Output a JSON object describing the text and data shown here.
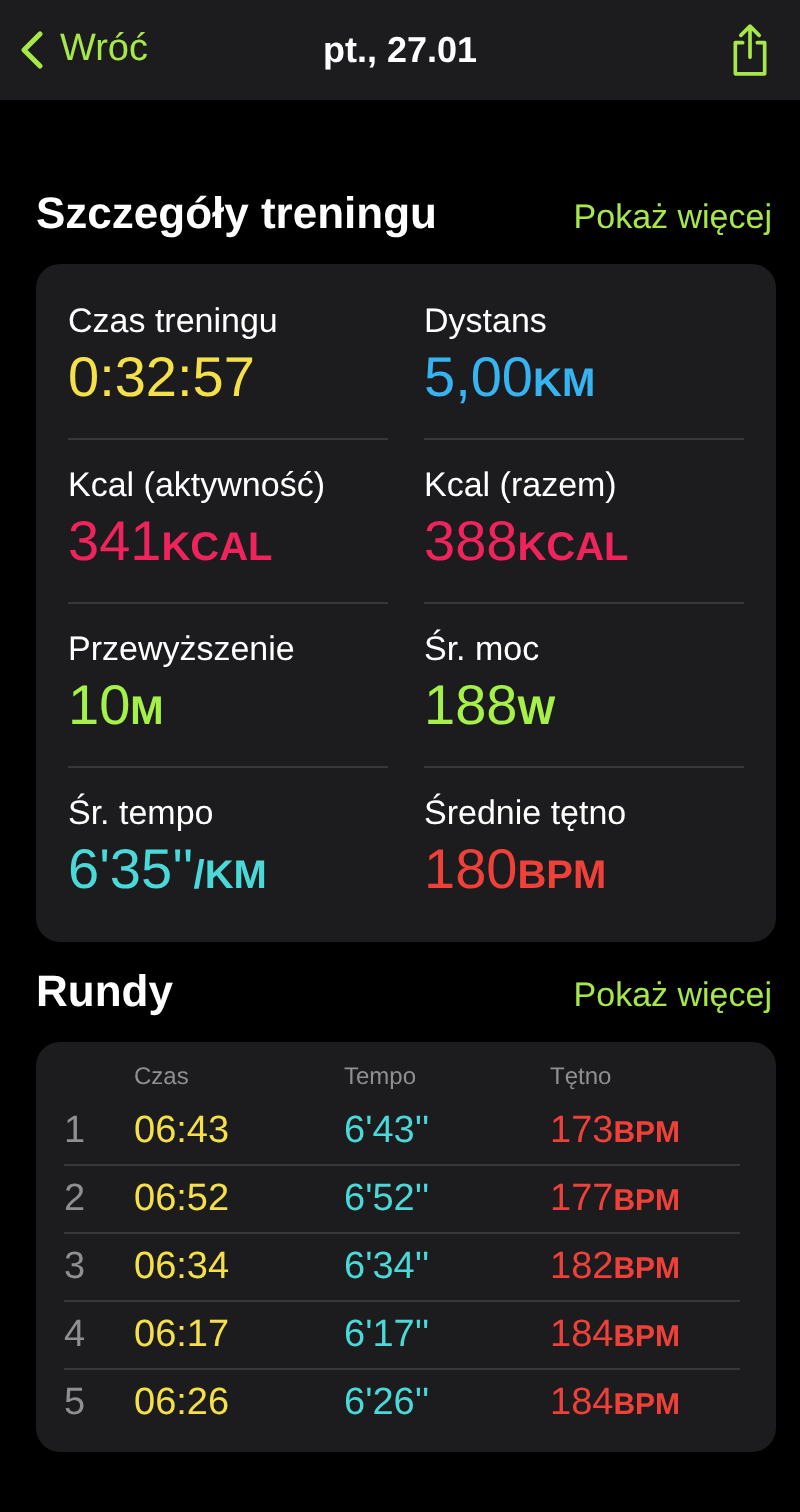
{
  "nav": {
    "back": "Wróć",
    "title": "pt., 27.01"
  },
  "details": {
    "title": "Szczegóły treningu",
    "more": "Pokaż więcej",
    "metrics": [
      {
        "label": "Czas treningu",
        "value": "0:32:57",
        "color": "#f5e04a"
      },
      {
        "label": "Dystans",
        "value": "5,00",
        "unit": "KM",
        "color": "#36b4f2"
      },
      {
        "label": "Kcal (aktywność)",
        "value": "341",
        "unit": "KCAL",
        "color": "#f0245c"
      },
      {
        "label": "Kcal (razem)",
        "value": "388",
        "unit": "KCAL",
        "color": "#f0245c"
      },
      {
        "label": "Przewyższenie",
        "value": "10",
        "unit": "M",
        "color": "#a6f04a"
      },
      {
        "label": "Śr. moc",
        "value": "188",
        "unit": "W",
        "color": "#a6f04a"
      },
      {
        "label": "Śr. tempo",
        "value": "6'35''",
        "unit": "/KM",
        "color": "#4ad8d8"
      },
      {
        "label": "Średnie tętno",
        "value": "180",
        "unit": "BPM",
        "color": "#f0403a"
      }
    ]
  },
  "rounds": {
    "title": "Rundy",
    "more": "Pokaż więcej",
    "columns": [
      "Czas",
      "Tempo",
      "Tętno"
    ],
    "rows": [
      {
        "index": "1",
        "time": "06:43",
        "pace": "6'43''",
        "hr": "173",
        "unit": "BPM"
      },
      {
        "index": "2",
        "time": "06:52",
        "pace": "6'52''",
        "hr": "177",
        "unit": "BPM"
      },
      {
        "index": "3",
        "time": "06:34",
        "pace": "6'34''",
        "hr": "182",
        "unit": "BPM"
      },
      {
        "index": "4",
        "time": "06:17",
        "pace": "6'17''",
        "hr": "184",
        "unit": "BPM"
      },
      {
        "index": "5",
        "time": "06:26",
        "pace": "6'26''",
        "hr": "184",
        "unit": "BPM"
      }
    ]
  }
}
